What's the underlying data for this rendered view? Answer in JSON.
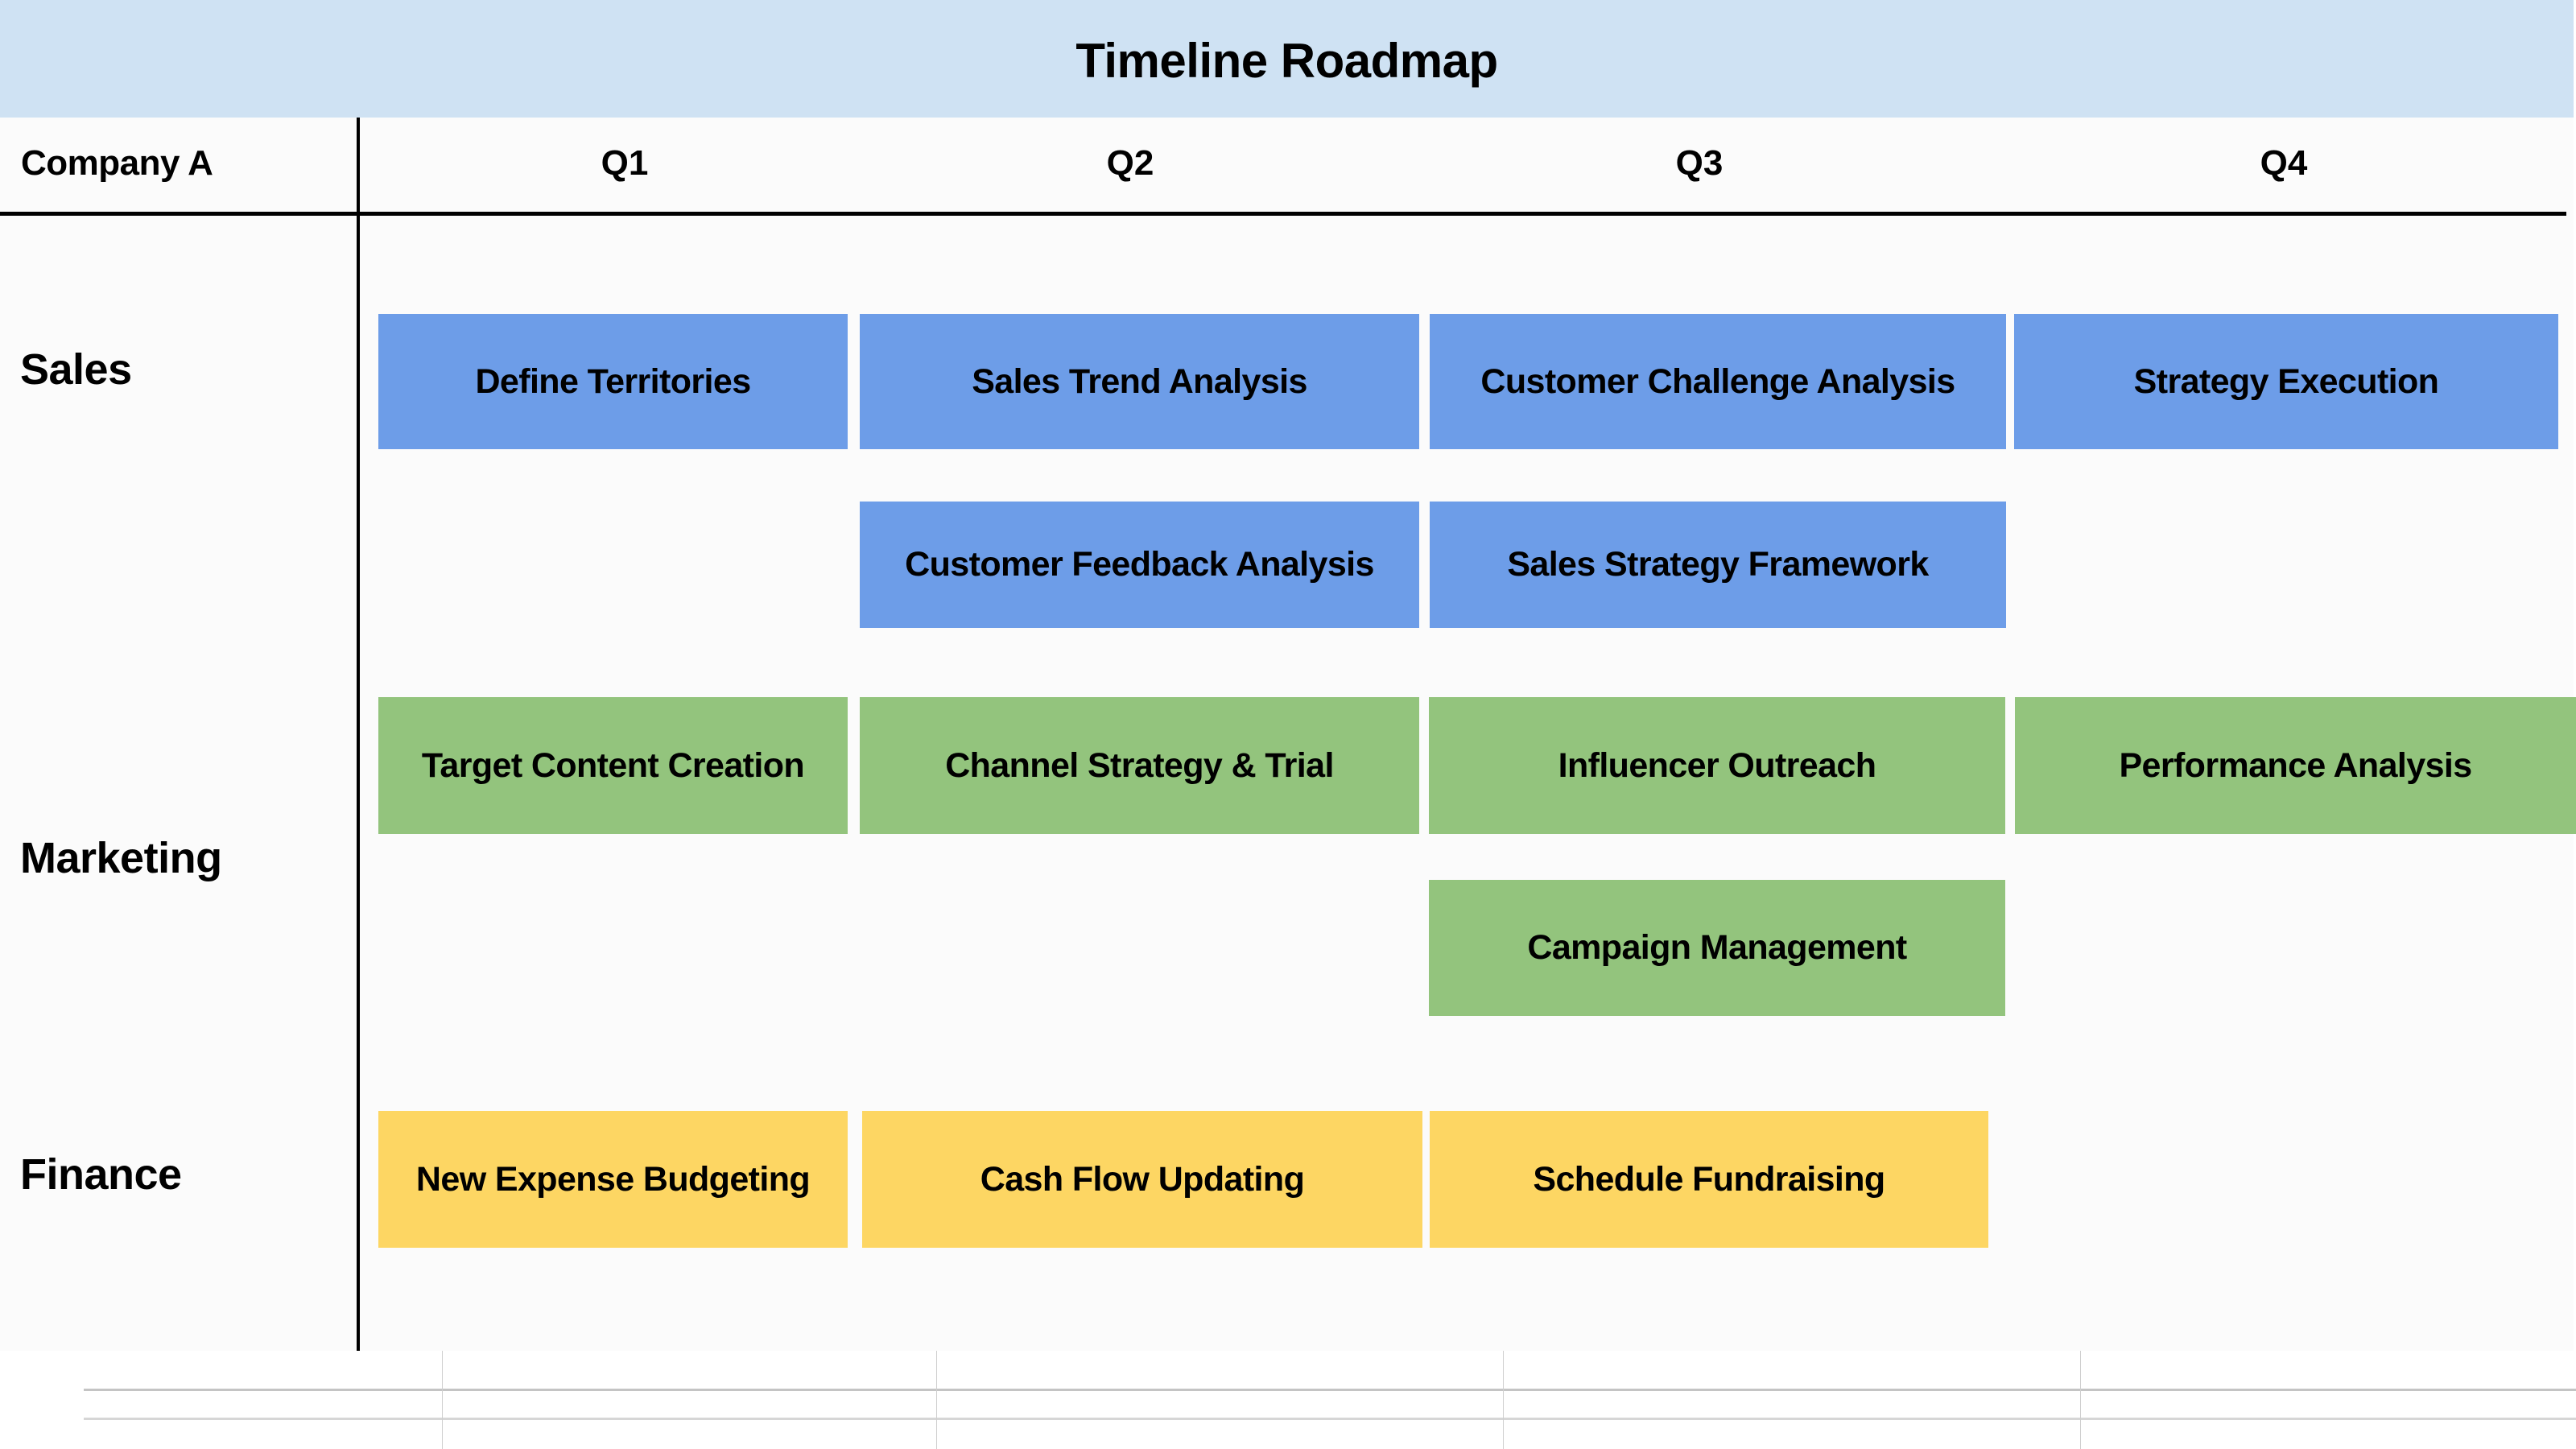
{
  "title": "Timeline Roadmap",
  "company": "Company A",
  "quarters": [
    "Q1",
    "Q2",
    "Q3",
    "Q4"
  ],
  "colors": {
    "header_band": "#cfe2f3",
    "sales": "#6d9de8",
    "marketing": "#93c47d",
    "finance": "#fdd663"
  },
  "rows": [
    {
      "label": "Sales",
      "tasks": [
        {
          "label": "Define Territories",
          "quarters": [
            "Q1"
          ],
          "lane": 1
        },
        {
          "label": "Sales Trend Analysis",
          "quarters": [
            "Q2"
          ],
          "lane": 1
        },
        {
          "label": "Customer Challenge Analysis",
          "quarters": [
            "Q3"
          ],
          "lane": 1
        },
        {
          "label": "Strategy Execution",
          "quarters": [
            "Q4"
          ],
          "lane": 1
        },
        {
          "label": "Customer Feedback Analysis",
          "quarters": [
            "Q2"
          ],
          "lane": 2
        },
        {
          "label": "Sales Strategy Framework",
          "quarters": [
            "Q3"
          ],
          "lane": 2
        }
      ]
    },
    {
      "label": "Marketing",
      "tasks": [
        {
          "label": "Target Content Creation",
          "quarters": [
            "Q1"
          ],
          "lane": 1
        },
        {
          "label": "Channel Strategy & Trial",
          "quarters": [
            "Q2"
          ],
          "lane": 1
        },
        {
          "label": "Influencer Outreach",
          "quarters": [
            "Q3"
          ],
          "lane": 1
        },
        {
          "label": "Performance Analysis",
          "quarters": [
            "Q4"
          ],
          "lane": 1
        },
        {
          "label": "Campaign Management",
          "quarters": [
            "Q3"
          ],
          "lane": 2
        }
      ]
    },
    {
      "label": "Finance",
      "tasks": [
        {
          "label": "New Expense Budgeting",
          "quarters": [
            "Q1"
          ],
          "lane": 1
        },
        {
          "label": "Cash Flow Updating",
          "quarters": [
            "Q2"
          ],
          "lane": 1
        },
        {
          "label": "Schedule Fundraising",
          "quarters": [
            "Q3"
          ],
          "lane": 1
        }
      ]
    }
  ]
}
